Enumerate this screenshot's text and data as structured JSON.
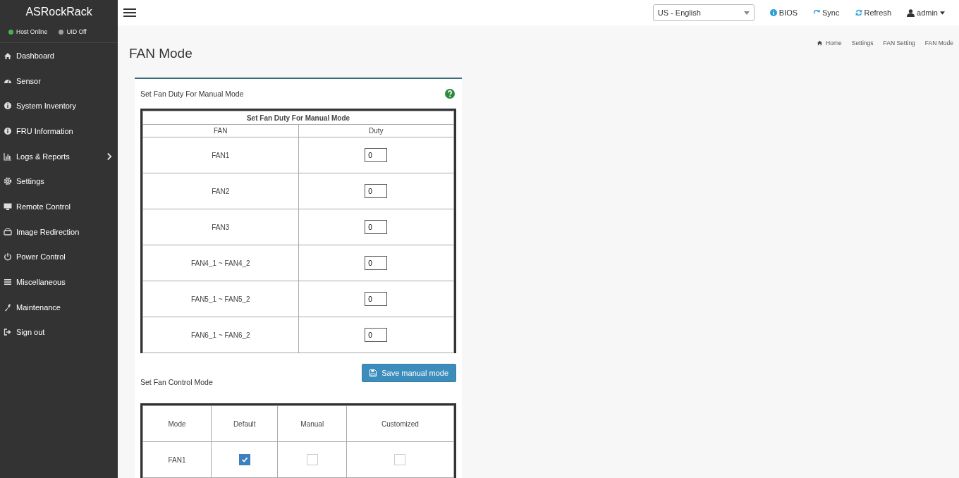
{
  "brand": "ASRockRack",
  "status": [
    {
      "label": "Host Online",
      "color": "#4caf50"
    },
    {
      "label": "UID Off",
      "color": "#9e9e9e"
    }
  ],
  "menu": [
    {
      "label": "Dashboard",
      "has_submenu": false
    },
    {
      "label": "Sensor",
      "has_submenu": false
    },
    {
      "label": "System Inventory",
      "has_submenu": false
    },
    {
      "label": "FRU Information",
      "has_submenu": false
    },
    {
      "label": "Logs & Reports",
      "has_submenu": true
    },
    {
      "label": "Settings",
      "has_submenu": false
    },
    {
      "label": "Remote Control",
      "has_submenu": false
    },
    {
      "label": "Image Redirection",
      "has_submenu": false
    },
    {
      "label": "Power Control",
      "has_submenu": false
    },
    {
      "label": "Miscellaneous",
      "has_submenu": false
    },
    {
      "label": "Maintenance",
      "has_submenu": false
    },
    {
      "label": "Sign out",
      "has_submenu": false
    }
  ],
  "topbar": {
    "language": "US - English",
    "links": [
      "BIOS",
      "Sync",
      "Refresh"
    ],
    "user": "admin"
  },
  "breadcrumb": [
    "Home",
    "Settings",
    "FAN Setting",
    "FAN Mode"
  ],
  "page_title": "FAN Mode",
  "duty": {
    "section_title": "Set Fan Duty For Manual Mode",
    "table_title": "Set Fan Duty For Manual Mode",
    "columns": [
      "FAN",
      "Duty"
    ],
    "rows": [
      {
        "fan": "FAN1",
        "value": "0"
      },
      {
        "fan": "FAN2",
        "value": "0"
      },
      {
        "fan": "FAN3",
        "value": "0"
      },
      {
        "fan": "FAN4_1 ~ FAN4_2",
        "value": "0"
      },
      {
        "fan": "FAN5_1 ~ FAN5_2",
        "value": "0"
      },
      {
        "fan": "FAN6_1 ~ FAN6_2",
        "value": "0"
      }
    ],
    "button": "Save manual mode"
  },
  "mode": {
    "section_title": "Set Fan Control Mode",
    "columns": [
      "Mode",
      "Default",
      "Manual",
      "Customized"
    ],
    "rows": [
      {
        "fan": "FAN1",
        "options": [
          {
            "checked": true
          },
          {
            "checked": false
          },
          {
            "checked": false
          }
        ]
      }
    ]
  }
}
